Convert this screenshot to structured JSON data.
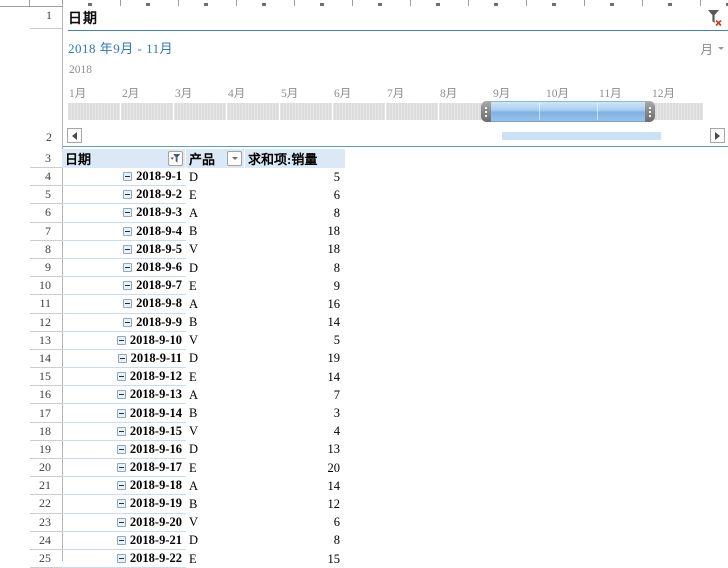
{
  "slicer": {
    "title": "日期",
    "selection_label": "2018 年9月 - 11月",
    "period_label": "月",
    "year_label": "2018",
    "months": [
      {
        "label": "1月",
        "selected": false
      },
      {
        "label": "2月",
        "selected": false
      },
      {
        "label": "3月",
        "selected": false
      },
      {
        "label": "4月",
        "selected": false
      },
      {
        "label": "5月",
        "selected": false
      },
      {
        "label": "6月",
        "selected": false
      },
      {
        "label": "7月",
        "selected": false
      },
      {
        "label": "8月",
        "selected": false
      },
      {
        "label": "9月",
        "selected": true
      },
      {
        "label": "10月",
        "selected": true
      },
      {
        "label": "11月",
        "selected": true
      },
      {
        "label": "12月",
        "selected": false
      }
    ]
  },
  "spreadsheet": {
    "row_number_1": "1",
    "row_number_2": "2",
    "header_row_number": "3"
  },
  "table": {
    "headers": {
      "date": "日期",
      "product": "产品",
      "value": "求和项:销量"
    },
    "rows": [
      {
        "n": "4",
        "date": "2018-9-1",
        "product": "D",
        "value": "5"
      },
      {
        "n": "5",
        "date": "2018-9-2",
        "product": "E",
        "value": "6"
      },
      {
        "n": "6",
        "date": "2018-9-3",
        "product": "A",
        "value": "8"
      },
      {
        "n": "7",
        "date": "2018-9-4",
        "product": "B",
        "value": "18"
      },
      {
        "n": "8",
        "date": "2018-9-5",
        "product": "V",
        "value": "18"
      },
      {
        "n": "9",
        "date": "2018-9-6",
        "product": "D",
        "value": "8"
      },
      {
        "n": "10",
        "date": "2018-9-7",
        "product": "E",
        "value": "9"
      },
      {
        "n": "11",
        "date": "2018-9-8",
        "product": "A",
        "value": "16"
      },
      {
        "n": "12",
        "date": "2018-9-9",
        "product": "B",
        "value": "14"
      },
      {
        "n": "13",
        "date": "2018-9-10",
        "product": "V",
        "value": "5"
      },
      {
        "n": "14",
        "date": "2018-9-11",
        "product": "D",
        "value": "19"
      },
      {
        "n": "15",
        "date": "2018-9-12",
        "product": "E",
        "value": "14"
      },
      {
        "n": "16",
        "date": "2018-9-13",
        "product": "A",
        "value": "7"
      },
      {
        "n": "17",
        "date": "2018-9-14",
        "product": "B",
        "value": "3"
      },
      {
        "n": "18",
        "date": "2018-9-15",
        "product": "V",
        "value": "4"
      },
      {
        "n": "19",
        "date": "2018-9-16",
        "product": "D",
        "value": "13"
      },
      {
        "n": "20",
        "date": "2018-9-17",
        "product": "E",
        "value": "20"
      },
      {
        "n": "21",
        "date": "2018-9-18",
        "product": "A",
        "value": "14"
      },
      {
        "n": "22",
        "date": "2018-9-19",
        "product": "B",
        "value": "12"
      },
      {
        "n": "23",
        "date": "2018-9-20",
        "product": "V",
        "value": "6"
      },
      {
        "n": "24",
        "date": "2018-9-21",
        "product": "D",
        "value": "8"
      },
      {
        "n": "25",
        "date": "2018-9-22",
        "product": "E",
        "value": "15"
      }
    ]
  },
  "icons": {
    "clear_filter": "funnel-with-red-x",
    "column_filter": "funnel-with-arrow",
    "dropdown": "chevron-down",
    "collapse": "minus-box",
    "scroll_left": "triangle-left",
    "scroll_right": "triangle-right"
  },
  "colors": {
    "accent_blue": "#2E75B6",
    "selection_label_blue": "#2878BE",
    "pill_blue": "#8FBEE8",
    "header_bg": "#DBE8F5",
    "row_line_blue": "#C7DCF2",
    "unselected_month_gray": "#DCDCDC"
  }
}
